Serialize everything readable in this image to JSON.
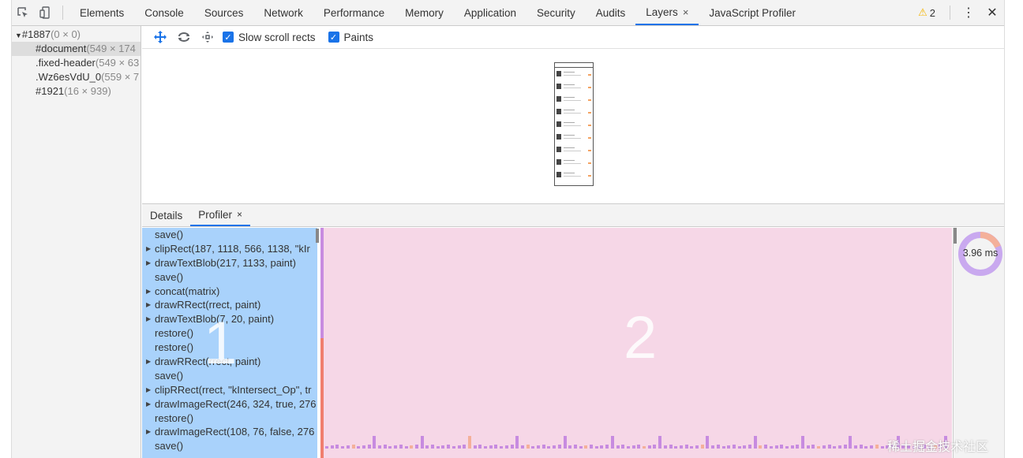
{
  "tabs": [
    {
      "label": "Elements"
    },
    {
      "label": "Console"
    },
    {
      "label": "Sources"
    },
    {
      "label": "Network"
    },
    {
      "label": "Performance"
    },
    {
      "label": "Memory"
    },
    {
      "label": "Application"
    },
    {
      "label": "Security"
    },
    {
      "label": "Audits"
    },
    {
      "label": "Layers",
      "active": true,
      "close": "×"
    },
    {
      "label": "JavaScript Profiler"
    }
  ],
  "warnings": {
    "count": "2"
  },
  "tree": [
    {
      "name": "#1887",
      "dim": "(0 × 0)",
      "expanded": "▼"
    },
    {
      "name": "#document",
      "dim": "(549 × 174"
    },
    {
      "name": ".fixed-header",
      "dim": "(549 × 63"
    },
    {
      "name": ".Wz6esVdU_0",
      "dim": "(559 × 7"
    },
    {
      "name": "#1921",
      "dim": "(16 × 939)"
    }
  ],
  "layers_toolbar": {
    "slow_scroll": "Slow scroll rects",
    "paints": "Paints"
  },
  "bottom_tabs": {
    "details": "Details",
    "profiler": "Profiler",
    "close": "×"
  },
  "commands": [
    {
      "text": "save()",
      "expandable": false
    },
    {
      "text": "clipRect(187, 1118, 566, 1138, \"kIr",
      "expandable": true
    },
    {
      "text": "drawTextBlob(217, 1133, paint)",
      "expandable": true
    },
    {
      "text": "save()",
      "expandable": false
    },
    {
      "text": "concat(matrix)",
      "expandable": true
    },
    {
      "text": "drawRRect(rrect, paint)",
      "expandable": true
    },
    {
      "text": "drawTextBlob(7, 20, paint)",
      "expandable": true
    },
    {
      "text": "restore()",
      "expandable": false
    },
    {
      "text": "restore()",
      "expandable": false
    },
    {
      "text": "drawRRect(rrect, paint)",
      "expandable": true
    },
    {
      "text": "save()",
      "expandable": false
    },
    {
      "text": "clipRRect(rrect, \"kIntersect_Op\", tr",
      "expandable": true
    },
    {
      "text": "drawImageRect(246, 324, true, 276",
      "expandable": true
    },
    {
      "text": "restore()",
      "expandable": false
    },
    {
      "text": "drawImageRect(108, 76, false, 276",
      "expandable": true
    },
    {
      "text": "save()",
      "expandable": false
    }
  ],
  "overlay_labels": {
    "one": "1",
    "two": "2"
  },
  "pie": {
    "label": "3.96 ms"
  },
  "watermark": "稀土掘金技术社区",
  "colors": {
    "accent": "#1a73e8",
    "cmd_bg": "#a9d2fb",
    "timeline_bg": "#f6d7e7",
    "bar": "#c78be0",
    "paint_bar": "#f07e6e"
  }
}
